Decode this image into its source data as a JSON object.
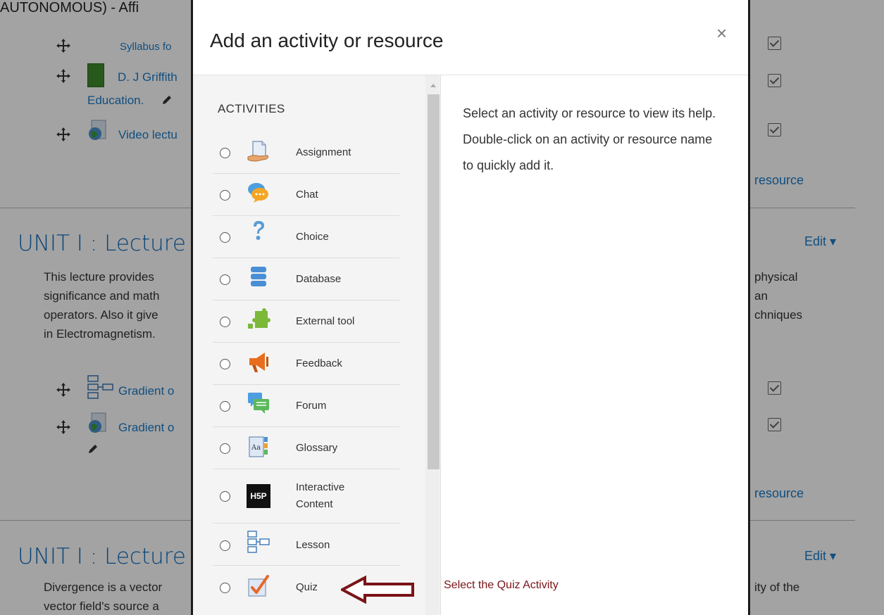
{
  "background": {
    "page_title": "AUTONOMOUS) - Affi",
    "top_items": [
      {
        "text": "Syllabus fo"
      },
      {
        "text": "D. J Griffith",
        "continuation": "Education."
      },
      {
        "text": "Video lectu"
      }
    ],
    "sections": [
      {
        "heading": "UNIT I : Lecture",
        "edit_label": "Edit",
        "summary_lines": [
          "This lecture provides",
          "significance and math",
          "operators. Also it give",
          "in Electromagnetism."
        ],
        "right_fragments": [
          "physical",
          "an",
          "chniques"
        ],
        "items": [
          {
            "text": "Gradient o"
          },
          {
            "text": "Gradient o"
          }
        ],
        "add_resource": "resource"
      },
      {
        "heading": "UNIT I : Lecture",
        "edit_label": "Edit",
        "summary_lines": [
          "Divergence is a vector",
          "vector field's source a"
        ],
        "right_fragments": [
          "ity of the"
        ]
      }
    ],
    "top_add_resource": "resource"
  },
  "modal": {
    "title": "Add an activity or resource",
    "close_label": "×",
    "list_heading": "ACTIVITIES",
    "activities": [
      {
        "label": "Assignment",
        "icon": "assignment-icon"
      },
      {
        "label": "Chat",
        "icon": "chat-icon"
      },
      {
        "label": "Choice",
        "icon": "choice-icon"
      },
      {
        "label": "Database",
        "icon": "database-icon"
      },
      {
        "label": "External tool",
        "icon": "external-tool-icon"
      },
      {
        "label": "Feedback",
        "icon": "feedback-icon"
      },
      {
        "label": "Forum",
        "icon": "forum-icon"
      },
      {
        "label": "Glossary",
        "icon": "glossary-icon"
      },
      {
        "label": "Interactive",
        "label2": "Content",
        "icon": "h5p-icon",
        "icon_text": "H5P"
      },
      {
        "label": "Lesson",
        "icon": "lesson-icon"
      },
      {
        "label": "Quiz",
        "icon": "quiz-icon"
      }
    ],
    "help_text": "Select an activity or resource to view its help. Double-click on an activity or resource name to quickly add it."
  },
  "annotation": {
    "text": "Select the Quiz Activity",
    "color": "#7a1418"
  },
  "colors": {
    "link": "#1a7cc9",
    "heading": "#0f6cbf",
    "overlay": "rgba(0,0,0,0.36)"
  }
}
